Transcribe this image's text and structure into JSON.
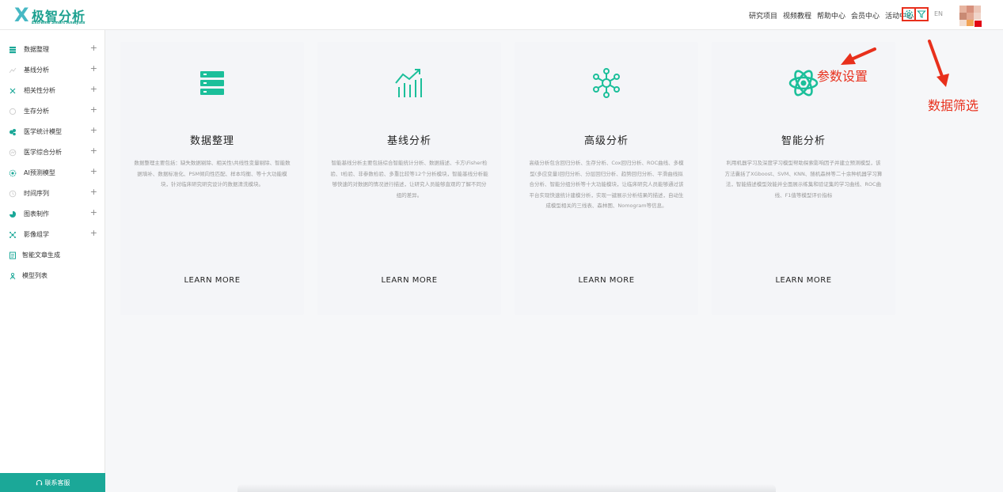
{
  "brand": {
    "mark": "X",
    "title": "极智分析",
    "subtitle": "Extreme Smart Analysis"
  },
  "topnav": [
    "研究项目",
    "视频教程",
    "帮助中心",
    "会员中心",
    "活动中心"
  ],
  "header_icons": [
    {
      "name": "settings-icon",
      "color": "#1ba898"
    },
    {
      "name": "filter-icon",
      "color": "#1ba898"
    }
  ],
  "lang": "EN",
  "sidebar": {
    "items": [
      {
        "label": "数据整理",
        "expandable": true,
        "icon": "database-icon"
      },
      {
        "label": "基线分析",
        "expandable": true,
        "icon": "line-chart-icon"
      },
      {
        "label": "相关性分析",
        "expandable": true,
        "icon": "scatter-icon"
      },
      {
        "label": "生存分析",
        "expandable": true,
        "icon": "pie-icon"
      },
      {
        "label": "医学统计模型",
        "expandable": true,
        "icon": "stats-model-icon"
      },
      {
        "label": "医学综合分析",
        "expandable": true,
        "icon": "comprehensive-icon"
      },
      {
        "label": "AI预测模型",
        "expandable": true,
        "icon": "ai-icon"
      },
      {
        "label": "时间序列",
        "expandable": true,
        "icon": "clock-icon"
      },
      {
        "label": "图表制作",
        "expandable": true,
        "icon": "chart-icon"
      },
      {
        "label": "影像组学",
        "expandable": true,
        "icon": "radiomics-icon"
      },
      {
        "label": "智能文章生成",
        "expandable": false,
        "icon": "article-icon"
      },
      {
        "label": "模型列表",
        "expandable": false,
        "icon": "model-list-icon"
      }
    ],
    "plus": "+",
    "contact_label": "联系客服"
  },
  "cards": [
    {
      "title": "数据整理",
      "icon": "server-icon",
      "desc": "数据整理主要包括：缺失数据剔除、相关性\\共线性变量剔除、智能数据填补、数据标准化、PSM倾向性匹配、样本均衡、等十大功能模块，针对临床研究研究设计的数据清洗模块。",
      "more": "LEARN MORE"
    },
    {
      "title": "基线分析",
      "icon": "trend-icon",
      "desc": "智能基线分析主要包括综合智能统计分析、数据描述、卡方\\Fisher检验、t检验、非参数检验、多重比较等12个分析模块，智能基线分析能够快速的对数据的情况进行描述，让研究人员能够直观的了解不同分组的差异。",
      "more": "LEARN MORE"
    },
    {
      "title": "高级分析",
      "icon": "network-icon",
      "desc": "高级分析包含回归分析、生存分析、Cox回归分析、ROC曲线、多模型(多应变量)回归分析、分层回归分析、趋势回归分析、平滑曲线拟合分析、智能分组分析等十大功能模块，让临床研究人员能够通过该平台实现快速统计建模分析，实现一键展示分析结果的描述，自动生成模型相关的三线表、森林图、Nomogram等信息。",
      "more": "LEARN MORE"
    },
    {
      "title": "智能分析",
      "icon": "atom-icon",
      "desc": "利用机器学习及深度学习模型帮助探索影响因子并建立预测模型，该方法囊括了XGboost、SVM、KNN、随机森林等二十余种机器学习算法，智能描述模型效能并全面展示练集和验证集的学习曲线、ROC曲线、F1值等模型评价指标",
      "more": "LEARN MORE"
    }
  ],
  "annotations": {
    "settings": "参数设置",
    "filter": "数据筛选"
  },
  "colors": {
    "accent": "#1ba898",
    "annotation": "#e8301c"
  }
}
